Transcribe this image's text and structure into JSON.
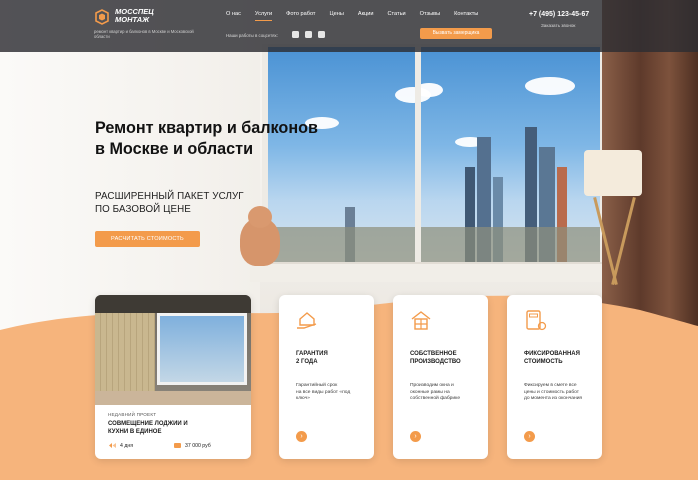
{
  "header": {
    "logo_line1": "МОССПЕЦ",
    "logo_line2": "МОНТАЖ",
    "logo_tagline": "ремонт квартир и балконов в Москве и Московской области",
    "nav": [
      {
        "label": "О нас",
        "active": false
      },
      {
        "label": "Услуги",
        "active": true
      },
      {
        "label": "Фото работ",
        "active": false
      },
      {
        "label": "Цены",
        "active": false
      },
      {
        "label": "Акции",
        "active": false
      },
      {
        "label": "Статьи",
        "active": false
      },
      {
        "label": "Отзывы",
        "active": false
      },
      {
        "label": "Контакты",
        "active": false
      }
    ],
    "social_label": "Наши работы в соцсетях:",
    "social_icons": [
      "instagram-icon",
      "youtube-icon",
      "vk-icon"
    ],
    "cta_label": "Вызвать замерщика",
    "phone": "+7 (495) 123-45-67",
    "callback_label": "Заказать звонок"
  },
  "hero": {
    "title_line1": "Ремонт квартир и балконов",
    "title_line2": "в Москве и области",
    "subtitle_line1": "РАСШИРЕННЫЙ ПАКЕТ УСЛУГ",
    "subtitle_line2": "ПО БАЗОВОЙ ЦЕНЕ",
    "button_label": "РАСЧИТАТЬ СТОИМОСТЬ"
  },
  "project_card": {
    "label": "НЕДАВНИЙ ПРОЕКТ",
    "title_line1": "СОВМЕЩЕНИЕ ЛОДЖИИ И",
    "title_line2": "КУХНИ В ЕДИНОЕ",
    "duration": "4 дня",
    "price": "37 000 руб"
  },
  "features": [
    {
      "icon": "house-hand-icon",
      "title_line1": "ГАРАНТИЯ",
      "title_line2": "2 ГОДА",
      "text_line1": "Гарантийный срок",
      "text_line2": "на все виды работ «под",
      "text_line3": "ключ»"
    },
    {
      "icon": "factory-window-icon",
      "title_line1": "СОБСТВЕННОЕ",
      "title_line2": "ПРОИЗВОДСТВО",
      "text_line1": "Производим окна и",
      "text_line2": "оконные рамы на",
      "text_line3": "собственной фабрике"
    },
    {
      "icon": "calculator-icon",
      "title_line1": "ФИКСИРОВАННАЯ",
      "title_line2": "СТОИМОСТЬ",
      "text_line1": "Фиксируем в смете все",
      "text_line2": "цены и стоимость работ",
      "text_line3": "до момента из окончания"
    }
  ],
  "colors": {
    "accent": "#f39b4b",
    "header_bg": "#2d2d32",
    "text_dark": "#121212"
  }
}
